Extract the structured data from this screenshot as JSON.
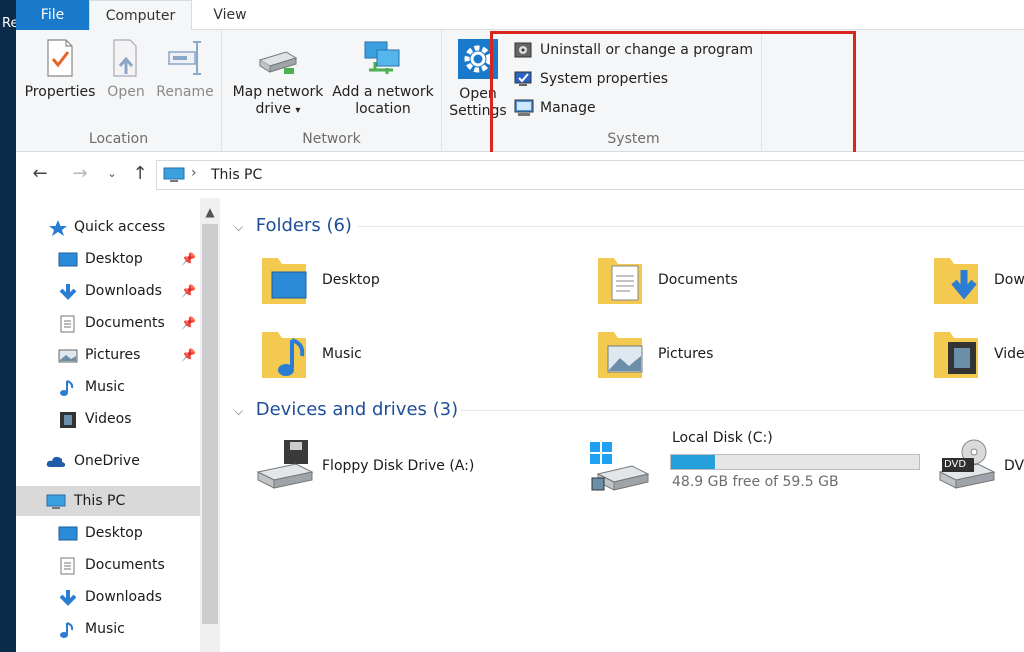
{
  "desktop": {
    "fragment": "Re"
  },
  "tabs": [
    {
      "label": "File"
    },
    {
      "label": "Computer"
    },
    {
      "label": "View"
    }
  ],
  "ribbon": {
    "location": {
      "label": "Location",
      "buttons": [
        {
          "label": "Properties"
        },
        {
          "label": "Open"
        },
        {
          "label": "Rename"
        }
      ]
    },
    "network": {
      "label": "Network",
      "map_drive_line1": "Map network",
      "map_drive_line2": "drive",
      "add_location_line1": "Add a network",
      "add_location_line2": "location"
    },
    "settings": {
      "line1": "Open",
      "line2": "Settings"
    },
    "system": {
      "label": "System",
      "items": [
        {
          "label": "Uninstall or change a program"
        },
        {
          "label": "System properties"
        },
        {
          "label": "Manage"
        }
      ]
    }
  },
  "address": {
    "crumb": "This PC",
    "separator": "›"
  },
  "nav": {
    "items": [
      {
        "label": "Quick access"
      },
      {
        "label": "Desktop"
      },
      {
        "label": "Downloads"
      },
      {
        "label": "Documents"
      },
      {
        "label": "Pictures"
      },
      {
        "label": "Music"
      },
      {
        "label": "Videos"
      },
      {
        "label": "OneDrive"
      },
      {
        "label": "This PC"
      },
      {
        "label": "Desktop"
      },
      {
        "label": "Documents"
      },
      {
        "label": "Downloads"
      },
      {
        "label": "Music"
      }
    ]
  },
  "content": {
    "folders_header": "Folders (6)",
    "folders": [
      {
        "label": "Desktop"
      },
      {
        "label": "Documents"
      },
      {
        "label": "Dow"
      },
      {
        "label": "Music"
      },
      {
        "label": "Pictures"
      },
      {
        "label": "Video"
      }
    ],
    "devices_header": "Devices and drives (3)",
    "drives": [
      {
        "label": "Floppy Disk Drive (A:)"
      },
      {
        "label": "Local Disk (C:)",
        "free": "48.9 GB free of 59.5 GB",
        "used_fraction": 0.178
      },
      {
        "label": "DVD"
      }
    ],
    "dvd_badge": "DVD"
  },
  "colors": {
    "accent": "#1979ca",
    "highlight": "#d9261c",
    "drive_fill": "#26a0da"
  }
}
